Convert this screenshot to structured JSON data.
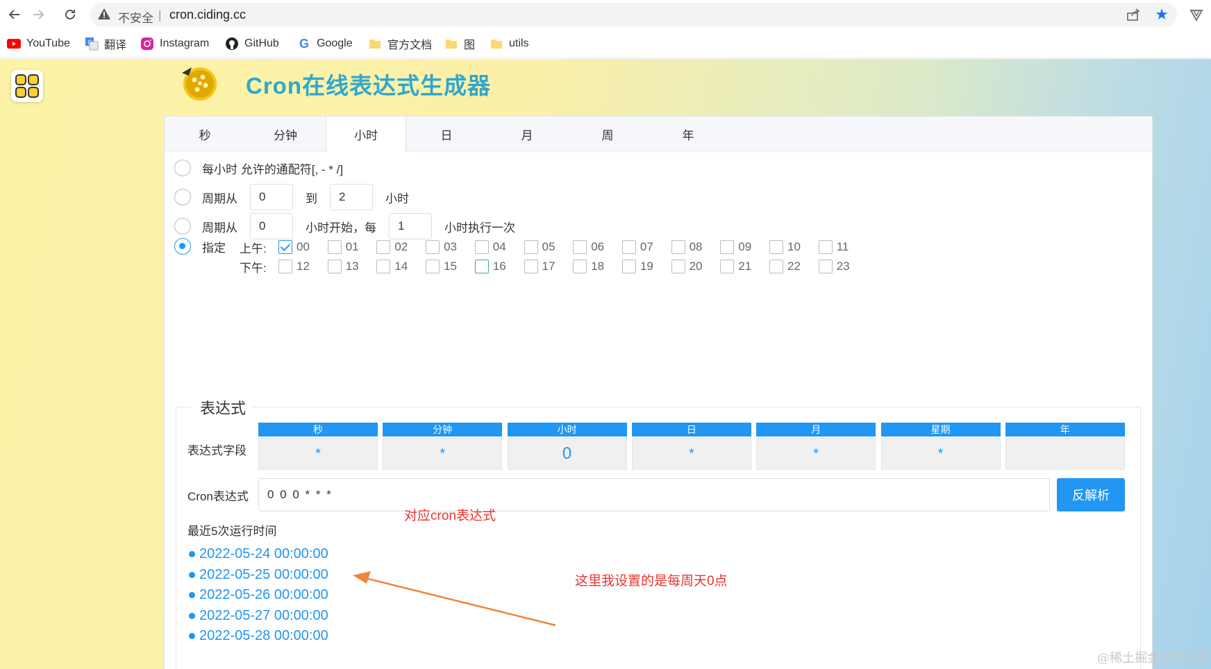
{
  "browser": {
    "security_label": "不安全",
    "separator": "|",
    "url": "cron.ciding.cc"
  },
  "bookmarks": [
    {
      "label": "YouTube",
      "icon": "youtube-icon"
    },
    {
      "label": "翻译",
      "icon": "translate-icon"
    },
    {
      "label": "Instagram",
      "icon": "instagram-icon"
    },
    {
      "label": "GitHub",
      "icon": "github-icon"
    },
    {
      "label": "Google",
      "icon": "google-icon"
    },
    {
      "label": "官方文档",
      "icon": "folder-icon"
    },
    {
      "label": "图",
      "icon": "folder-icon"
    },
    {
      "label": "utils",
      "icon": "folder-icon"
    }
  ],
  "site": {
    "title": "Cron在线表达式生成器"
  },
  "tabs": [
    {
      "label": "秒"
    },
    {
      "label": "分钟"
    },
    {
      "label": "小时",
      "active": true
    },
    {
      "label": "日"
    },
    {
      "label": "月"
    },
    {
      "label": "周"
    },
    {
      "label": "年"
    }
  ],
  "options": {
    "every": {
      "label": "每小时 允许的通配符[, - * /]"
    },
    "range": {
      "prefix": "周期从",
      "from": "0",
      "mid": "到",
      "to": "2",
      "suffix": "小时"
    },
    "step": {
      "prefix": "周期从",
      "start": "0",
      "mid": "小时开始，每",
      "every": "1",
      "suffix": "小时执行一次"
    },
    "specify": {
      "label": "指定",
      "selected": true,
      "am_label": "上午:",
      "pm_label": "下午:"
    }
  },
  "hours_am": [
    "00",
    "01",
    "02",
    "03",
    "04",
    "05",
    "06",
    "07",
    "08",
    "09",
    "10",
    "11"
  ],
  "hours_pm": [
    "12",
    "13",
    "14",
    "15",
    "16",
    "17",
    "18",
    "19",
    "20",
    "21",
    "22",
    "23"
  ],
  "checked_hours": [
    "00"
  ],
  "expression": {
    "legend": "表达式",
    "field_row_label": "表达式字段",
    "fields": [
      {
        "name": "秒",
        "value": "*"
      },
      {
        "name": "分钟",
        "value": "*"
      },
      {
        "name": "小时",
        "value": "0"
      },
      {
        "name": "日",
        "value": "*"
      },
      {
        "name": "月",
        "value": "*"
      },
      {
        "name": "星期",
        "value": "*"
      },
      {
        "name": "年",
        "value": ""
      }
    ],
    "cron_label": "Cron表达式",
    "cron_value": "0 0 0 * * *",
    "parse_button": "反解析",
    "recent_label": "最近5次运行时间",
    "recent_runs": [
      "2022-05-24 00:00:00",
      "2022-05-25 00:00:00",
      "2022-05-26 00:00:00",
      "2022-05-27 00:00:00",
      "2022-05-28 00:00:00"
    ]
  },
  "annotations": {
    "cron_note": "对应cron表达式",
    "setting_note": "这里我设置的是每周天0点"
  },
  "watermark": "@稀土掘金技术社区",
  "colors": {
    "accent": "#2196f3",
    "title": "#2fa7cf",
    "annotation": "#e8352f",
    "arrow": "#f0843c"
  }
}
